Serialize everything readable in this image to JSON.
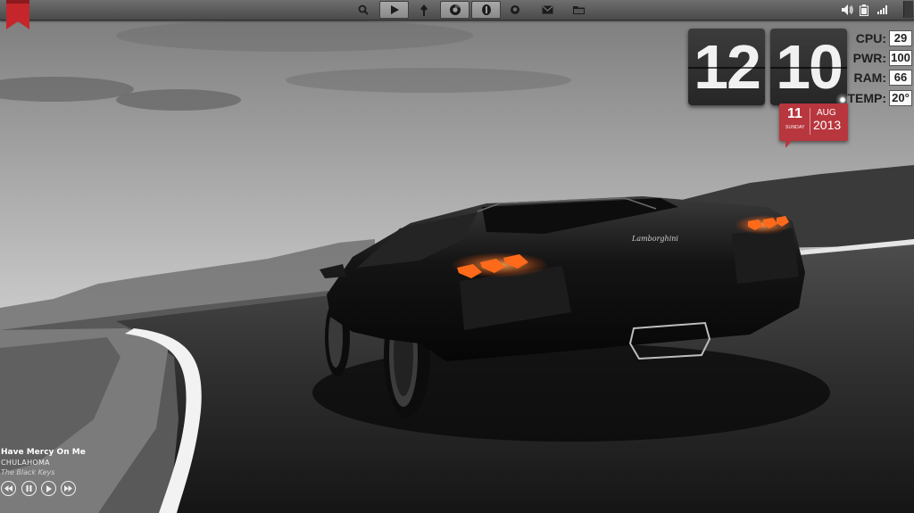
{
  "dock": {
    "items": [
      {
        "icon": "search-icon"
      },
      {
        "icon": "play-icon",
        "pressed": true
      },
      {
        "icon": "plugin-icon"
      },
      {
        "icon": "chrome-icon",
        "pressed": true
      },
      {
        "icon": "shield-icon",
        "pressed": true
      },
      {
        "icon": "github-icon"
      },
      {
        "icon": "mail-icon"
      },
      {
        "icon": "folder-icon"
      }
    ]
  },
  "tray": {
    "items": [
      {
        "icon": "volume-icon"
      },
      {
        "icon": "battery-icon"
      },
      {
        "icon": "wifi-signal-icon"
      },
      {
        "icon": "show-desktop-icon"
      }
    ]
  },
  "clock": {
    "hours": "12",
    "minutes": "10",
    "day": "11",
    "weekday": "SUNDAY",
    "month": "AUG",
    "year": "2013",
    "accent_color": "#b8363d"
  },
  "stats": {
    "cpu_label": "CPU:",
    "cpu_value": "29",
    "pwr_label": "PWR:",
    "pwr_value": "100",
    "ram_label": "RAM:",
    "ram_value": "66",
    "temp_label": "TEMP:",
    "temp_value": "20°"
  },
  "player": {
    "title": "Have Mercy On Me",
    "album": "CHULAHOMA",
    "artist": "The Black Keys",
    "controls": [
      "previous-icon",
      "pause-icon",
      "play-icon",
      "next-icon"
    ]
  },
  "wallpaper": {
    "subject": "Lamborghini",
    "taillight_color": "#ff6a1a"
  }
}
